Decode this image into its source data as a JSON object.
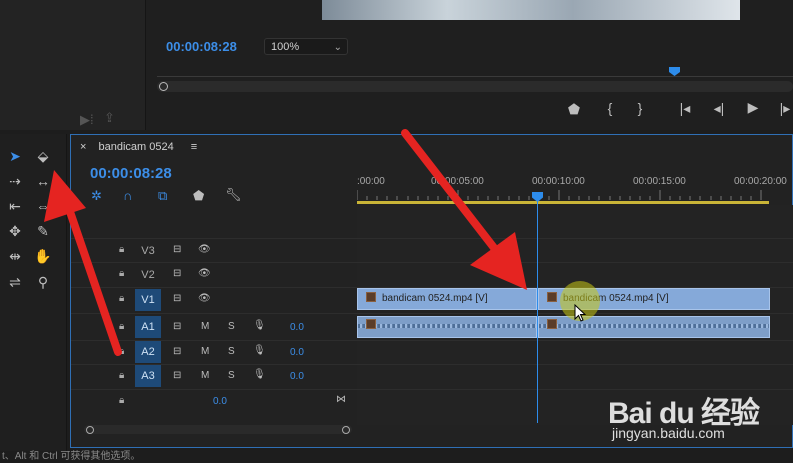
{
  "program_monitor": {
    "timecode": "00:00:08:28",
    "zoom": "100%",
    "transport_buttons": [
      "marker-icon",
      "mark-in-icon",
      "mark-out-icon",
      "go-to-in-icon",
      "step-back-icon",
      "play-icon",
      "step-forward-icon"
    ]
  },
  "timeline": {
    "sequence_name": "bandicam 0524",
    "menu_glyph": "≡",
    "close_glyph": "×",
    "timecode": "00:00:08:28",
    "ruler_labels": [
      ":00:00",
      "00:00:05:00",
      "00:00:10:00",
      "00:00:15:00",
      "00:00:20:00"
    ],
    "tracks": [
      {
        "name": "V3",
        "type": "video",
        "active": false
      },
      {
        "name": "V2",
        "type": "video",
        "active": false
      },
      {
        "name": "V1",
        "type": "video",
        "active": true
      },
      {
        "name": "A1",
        "type": "audio",
        "active": true,
        "mute": "M",
        "solo": "S",
        "volume": "0.0"
      },
      {
        "name": "A2",
        "type": "audio",
        "active": true,
        "mute": "M",
        "solo": "S",
        "volume": "0.0"
      },
      {
        "name": "A3",
        "type": "audio",
        "active": true,
        "mute": "M",
        "solo": "S",
        "volume": "0.0"
      }
    ],
    "master_volume": "0.0",
    "clips": [
      {
        "track": "V1",
        "label": "bandicam 0524.mp4 [V]"
      },
      {
        "track": "V1",
        "label": "bandicam 0524.mp4 [V]"
      }
    ]
  },
  "status_bar": {
    "text": "t、Alt 和 Ctrl 可获得其他选项。"
  },
  "watermark": {
    "brand": "Bai du 经验",
    "url": "jingyan.baidu.com"
  },
  "colors": {
    "accent": "#3c8ee8",
    "clip_video": "#85a9d9",
    "work_area": "#c9b437",
    "arrow": "#e52421"
  }
}
